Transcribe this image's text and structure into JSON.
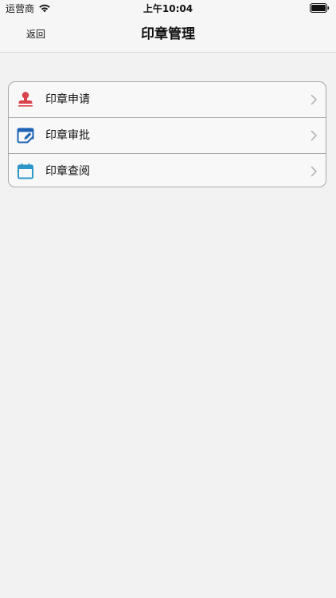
{
  "status_bar": {
    "carrier": "运营商",
    "time": "上午10:04",
    "wifi_icon": "wifi-icon",
    "battery_icon": "battery-icon"
  },
  "nav": {
    "back_label": "返回",
    "title": "印章管理"
  },
  "menu": {
    "items": [
      {
        "label": "印章申请",
        "icon": "stamp-icon",
        "icon_color": "#d9414b"
      },
      {
        "label": "印章审批",
        "icon": "edit-window-icon",
        "icon_color": "#1f63b7"
      },
      {
        "label": "印章查阅",
        "icon": "calendar-icon",
        "icon_color": "#2d96c8"
      }
    ],
    "chevron_icon": "chevron-right-icon"
  },
  "colors": {
    "background": "#f2f2f2",
    "bar_background": "#f6f6f6",
    "card_border": "#a8a8a8",
    "chevron": "#b5b5b5"
  }
}
